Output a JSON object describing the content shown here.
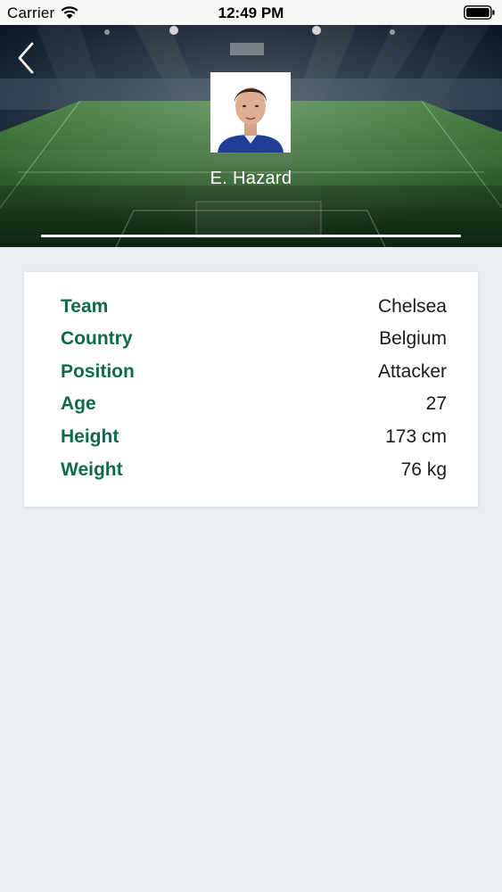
{
  "status_bar": {
    "carrier": "Carrier",
    "time": "12:49 PM",
    "wifi_icon": "wifi-icon",
    "battery_icon": "battery-icon"
  },
  "header": {
    "back_icon": "chevron-left-icon",
    "player_name": "E. Hazard"
  },
  "info": [
    {
      "label": "Team",
      "value": "Chelsea"
    },
    {
      "label": "Country",
      "value": "Belgium"
    },
    {
      "label": "Position",
      "value": "Attacker"
    },
    {
      "label": "Age",
      "value": "27"
    },
    {
      "label": "Height",
      "value": "173 cm"
    },
    {
      "label": "Weight",
      "value": "76 kg"
    }
  ],
  "colors": {
    "label": "#0f6a4a",
    "background": "#ebeef0",
    "card": "#ffffff"
  }
}
